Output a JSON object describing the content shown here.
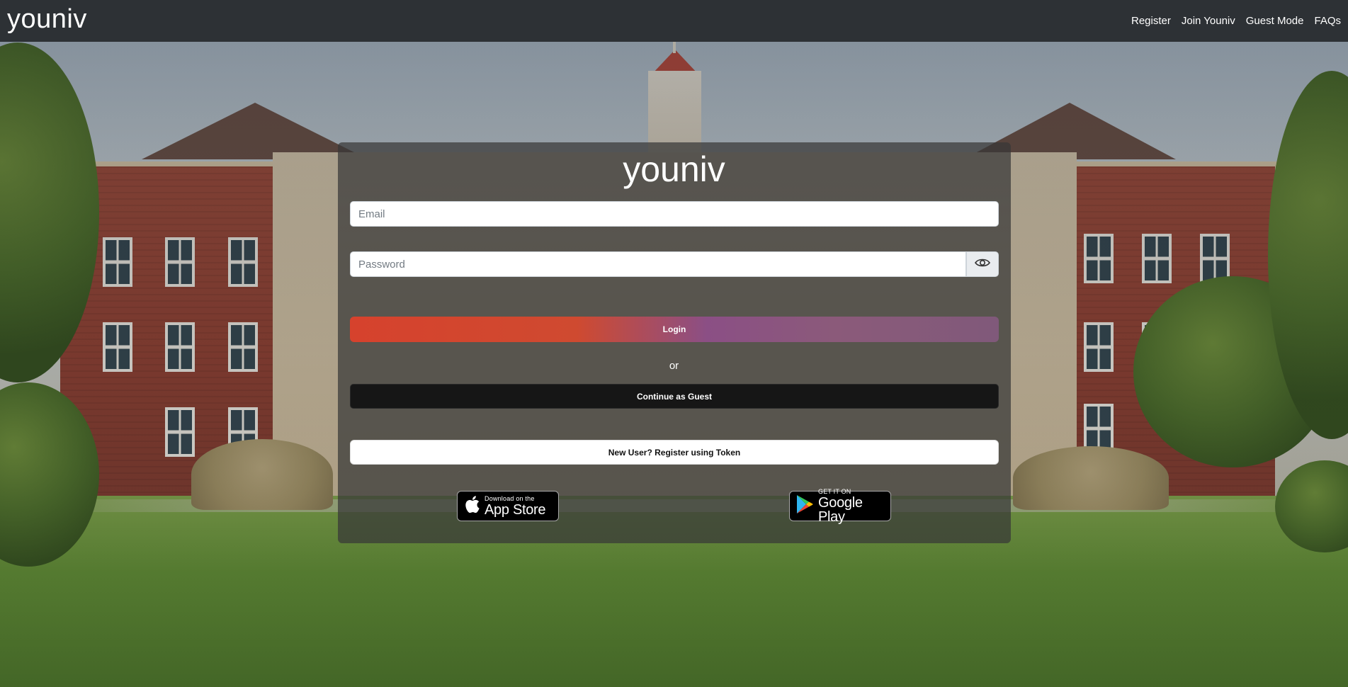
{
  "navbar": {
    "brand": "youniv",
    "links": [
      {
        "label": "Register"
      },
      {
        "label": "Join Youniv"
      },
      {
        "label": "Guest Mode"
      },
      {
        "label": "FAQs"
      }
    ]
  },
  "login": {
    "logo": "youniv",
    "email_placeholder": "Email",
    "password_placeholder": "Password",
    "password_toggle_icon": "eye-icon",
    "login_label": "Login",
    "or_label": "or",
    "guest_label": "Continue as Guest",
    "register_label": "New User? Register using Token"
  },
  "badges": {
    "appstore_small": "Download on the",
    "appstore_big": "App Store",
    "appstore_icon": "apple-icon",
    "googleplay_small": "GET IT ON",
    "googleplay_big": "Google Play",
    "googleplay_icon": "google-play-icon"
  },
  "colors": {
    "navbar_bg": "#2d3135",
    "login_gradient_start": "#d6422d",
    "login_gradient_end": "#80597a",
    "guest_bg": "#161616"
  }
}
